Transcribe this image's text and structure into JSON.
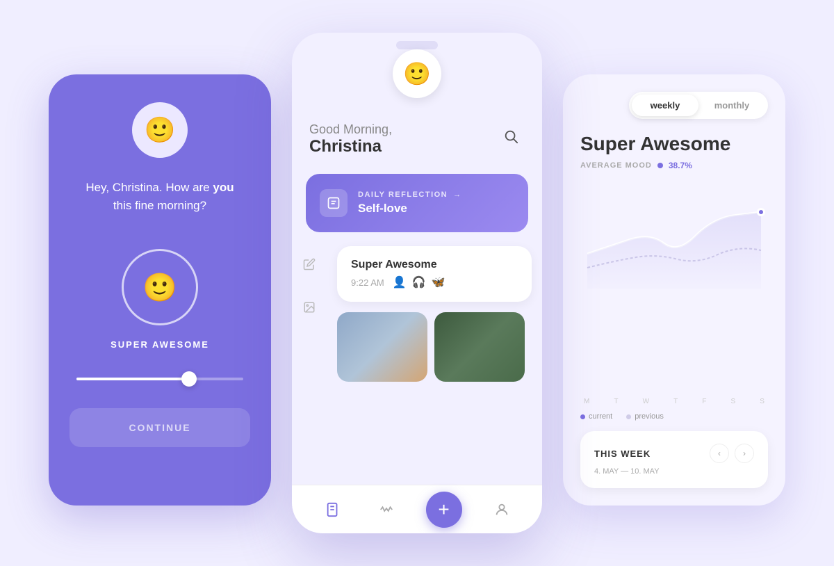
{
  "left_phone": {
    "greeting": "Hey, Christina. How are you this fine morning?",
    "greeting_bold": "you",
    "mood_label": "SUPER AWESOME",
    "continue_btn": "CONTINUE",
    "mascot_face": "😊",
    "mood_face": "😊"
  },
  "center_phone": {
    "greeting_light": "Good Morning,",
    "greeting_bold": "Christina",
    "daily_reflection_label": "DAILY REFLECTION",
    "daily_reflection_arrow": "→",
    "daily_reflection_topic": "Self-love",
    "mood_entry_title": "Super Awesome",
    "mood_entry_time": "9:22 AM",
    "bottom_nav": [
      "📋",
      "〜",
      "👤"
    ]
  },
  "right_phone": {
    "toggle_weekly": "weekly",
    "toggle_monthly": "monthly",
    "mood_title": "Super Awesome",
    "avg_label": "AVERAGE MOOD",
    "avg_value": "38.7%",
    "chart_days": [
      "M",
      "T",
      "W",
      "T",
      "F",
      "S",
      "S"
    ],
    "legend_current": "current",
    "legend_previous": "previous",
    "this_week_title": "THIS WEEK",
    "this_week_dates": "4. MAY — 10. MAY"
  },
  "colors": {
    "purple": "#7b6fe0",
    "light_purple": "#f2f0ff",
    "bg": "#ece9ff"
  }
}
